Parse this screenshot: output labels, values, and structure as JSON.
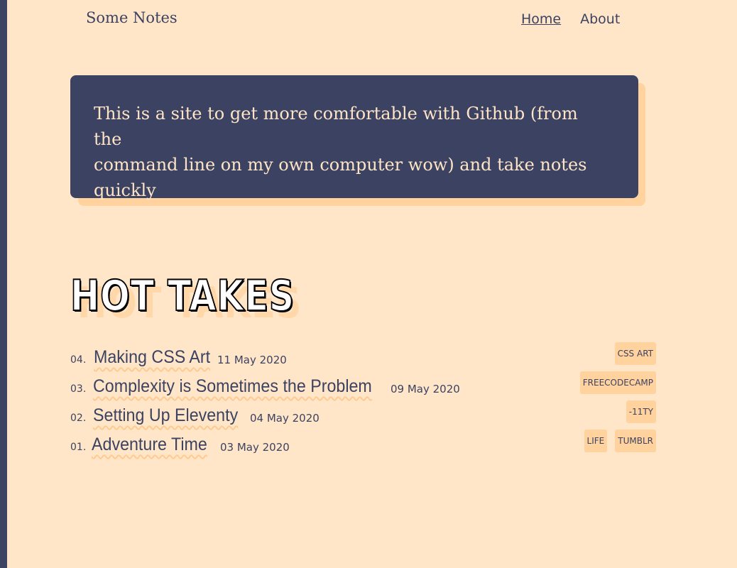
{
  "site": {
    "title": "Some Notes"
  },
  "nav": {
    "items": [
      {
        "label": "Home",
        "active": true
      },
      {
        "label": "About",
        "active": false
      }
    ]
  },
  "intro": {
    "line1": "This is a site to get more comfortable with Github (from the",
    "line2": "command line on my own computer wow) and take notes",
    "line3": "quickly"
  },
  "section": {
    "heading": "HOT TAKES"
  },
  "posts": [
    {
      "num": "04.",
      "title": "Making CSS Art",
      "date": "11 May 2020",
      "tags": [
        "CSS ART"
      ]
    },
    {
      "num": "03.",
      "title": "Complexity is Sometimes the Problem",
      "date": "09 May 2020",
      "tags": [
        "FREECODECAMP"
      ]
    },
    {
      "num": "02.",
      "title": "Setting Up Eleventy",
      "date": "04 May 2020",
      "tags": [
        "-11TY"
      ]
    },
    {
      "num": "01.",
      "title": "Adventure Time",
      "date": "03 May 2020",
      "tags": [
        "LIFE",
        "TUMBLR"
      ]
    }
  ],
  "colors": {
    "background": "#ffe6c8",
    "accent_dark": "#3c4261",
    "accent_light": "#ffd29e",
    "intro_text": "#fde4c6"
  }
}
